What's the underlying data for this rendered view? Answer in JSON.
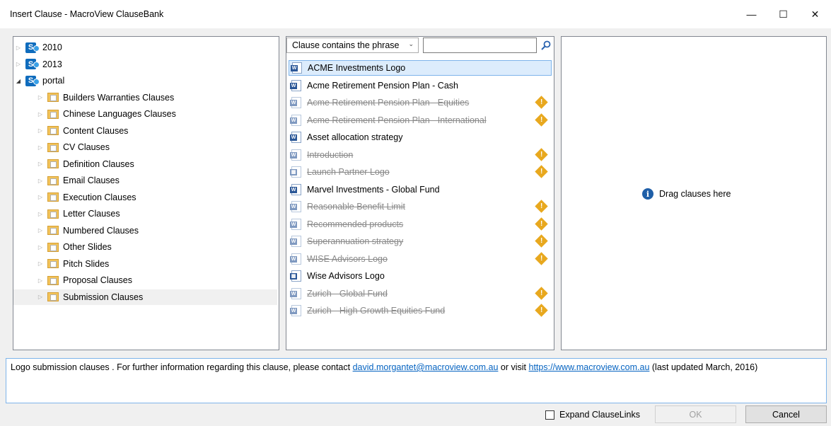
{
  "window": {
    "title": "Insert Clause - MacroView ClauseBank",
    "minimize": "—",
    "maximize": "☐",
    "close": "✕"
  },
  "tree": {
    "sites": [
      {
        "label": "2010",
        "expanded": false
      },
      {
        "label": "2013",
        "expanded": false
      },
      {
        "label": "portal",
        "expanded": true
      }
    ],
    "folders": [
      "Builders Warranties Clauses",
      "Chinese Languages Clauses",
      "Content Clauses",
      "CV Clauses",
      "Definition Clauses",
      "Email Clauses",
      "Execution Clauses",
      "Letter Clauses",
      "Numbered Clauses",
      "Other Slides",
      "Pitch Slides",
      "Proposal Clauses",
      "Submission Clauses"
    ],
    "selected_folder": "Submission Clauses"
  },
  "filter": {
    "mode": "Clause contains the phrase",
    "search_value": ""
  },
  "clauses": [
    {
      "label": "ACME Investments Logo",
      "kind": "word",
      "strike": false,
      "warning": false,
      "selected": true
    },
    {
      "label": "Acme Retirement Pension Plan - Cash",
      "kind": "word",
      "strike": false,
      "warning": false
    },
    {
      "label": "Acme Retirement Pension Plan - Equities",
      "kind": "word",
      "strike": true,
      "warning": true
    },
    {
      "label": "Acme Retirement Pension Plan - International",
      "kind": "word",
      "strike": true,
      "warning": true
    },
    {
      "label": "Asset allocation strategy",
      "kind": "word",
      "strike": false,
      "warning": false
    },
    {
      "label": "Introduction",
      "kind": "word",
      "strike": true,
      "warning": true
    },
    {
      "label": "Launch Partner Logo",
      "kind": "picture",
      "strike": true,
      "warning": true
    },
    {
      "label": "Marvel Investments - Global Fund",
      "kind": "word",
      "strike": false,
      "warning": false
    },
    {
      "label": "Reasonable Benefit Limit",
      "kind": "word",
      "strike": true,
      "warning": true
    },
    {
      "label": "Recommended products",
      "kind": "word",
      "strike": true,
      "warning": true
    },
    {
      "label": "Superannuation strategy",
      "kind": "word",
      "strike": true,
      "warning": true
    },
    {
      "label": "WISE Advisors Logo",
      "kind": "word",
      "strike": true,
      "warning": true
    },
    {
      "label": "Wise Advisors Logo",
      "kind": "picture",
      "strike": false,
      "warning": false
    },
    {
      "label": "Zurich - Global Fund",
      "kind": "word",
      "strike": true,
      "warning": true
    },
    {
      "label": "Zurich - High Growth Equities Fund",
      "kind": "word",
      "strike": true,
      "warning": true
    }
  ],
  "drop_zone": {
    "message": "Drag clauses here"
  },
  "description": {
    "text_before": "Logo submission clauses . For further information regarding this clause, please contact ",
    "email": "david.morgantet@macroview.com.au",
    "text_mid": " or visit ",
    "url": "https://www.macroview.com.au",
    "text_after": " (last updated March, 2016)"
  },
  "footer": {
    "expand_label": "Expand ClauseLinks",
    "expand_checked": false,
    "ok_label": "OK",
    "cancel_label": "Cancel"
  }
}
